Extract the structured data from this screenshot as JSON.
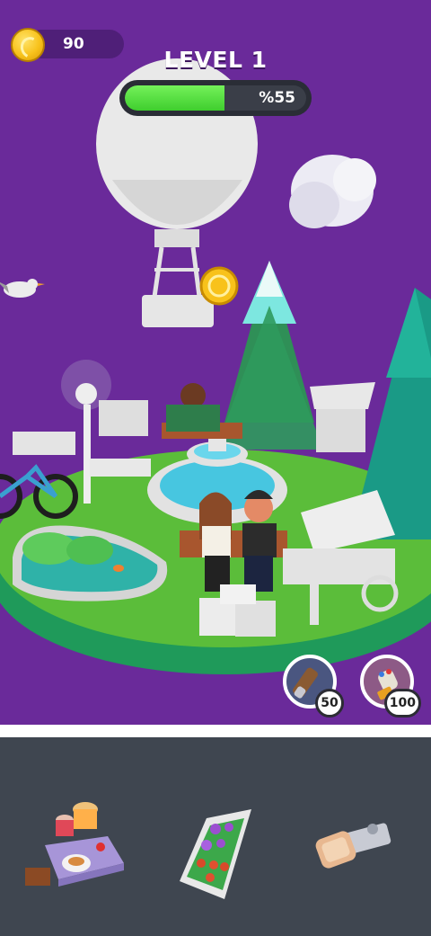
{
  "hud": {
    "coins": "90",
    "level_title": "LEVEL 1",
    "progress_label": "%55",
    "progress_fraction": 0.55
  },
  "boosters": [
    {
      "icon": "binoculars-icon",
      "cost": "50"
    },
    {
      "icon": "glove-icon",
      "cost": "100"
    }
  ],
  "tray": {
    "items": [
      {
        "icon": "picnic-table-icon"
      },
      {
        "icon": "flower-bed-icon"
      },
      {
        "icon": "bread-toast-icon"
      }
    ]
  },
  "colors": {
    "sky": "#6a2a9a",
    "grass": "#5bbd3a",
    "water": "#3fc2d8",
    "progress_fill": "#4fdc3a",
    "tray_background": "#3f4650"
  }
}
